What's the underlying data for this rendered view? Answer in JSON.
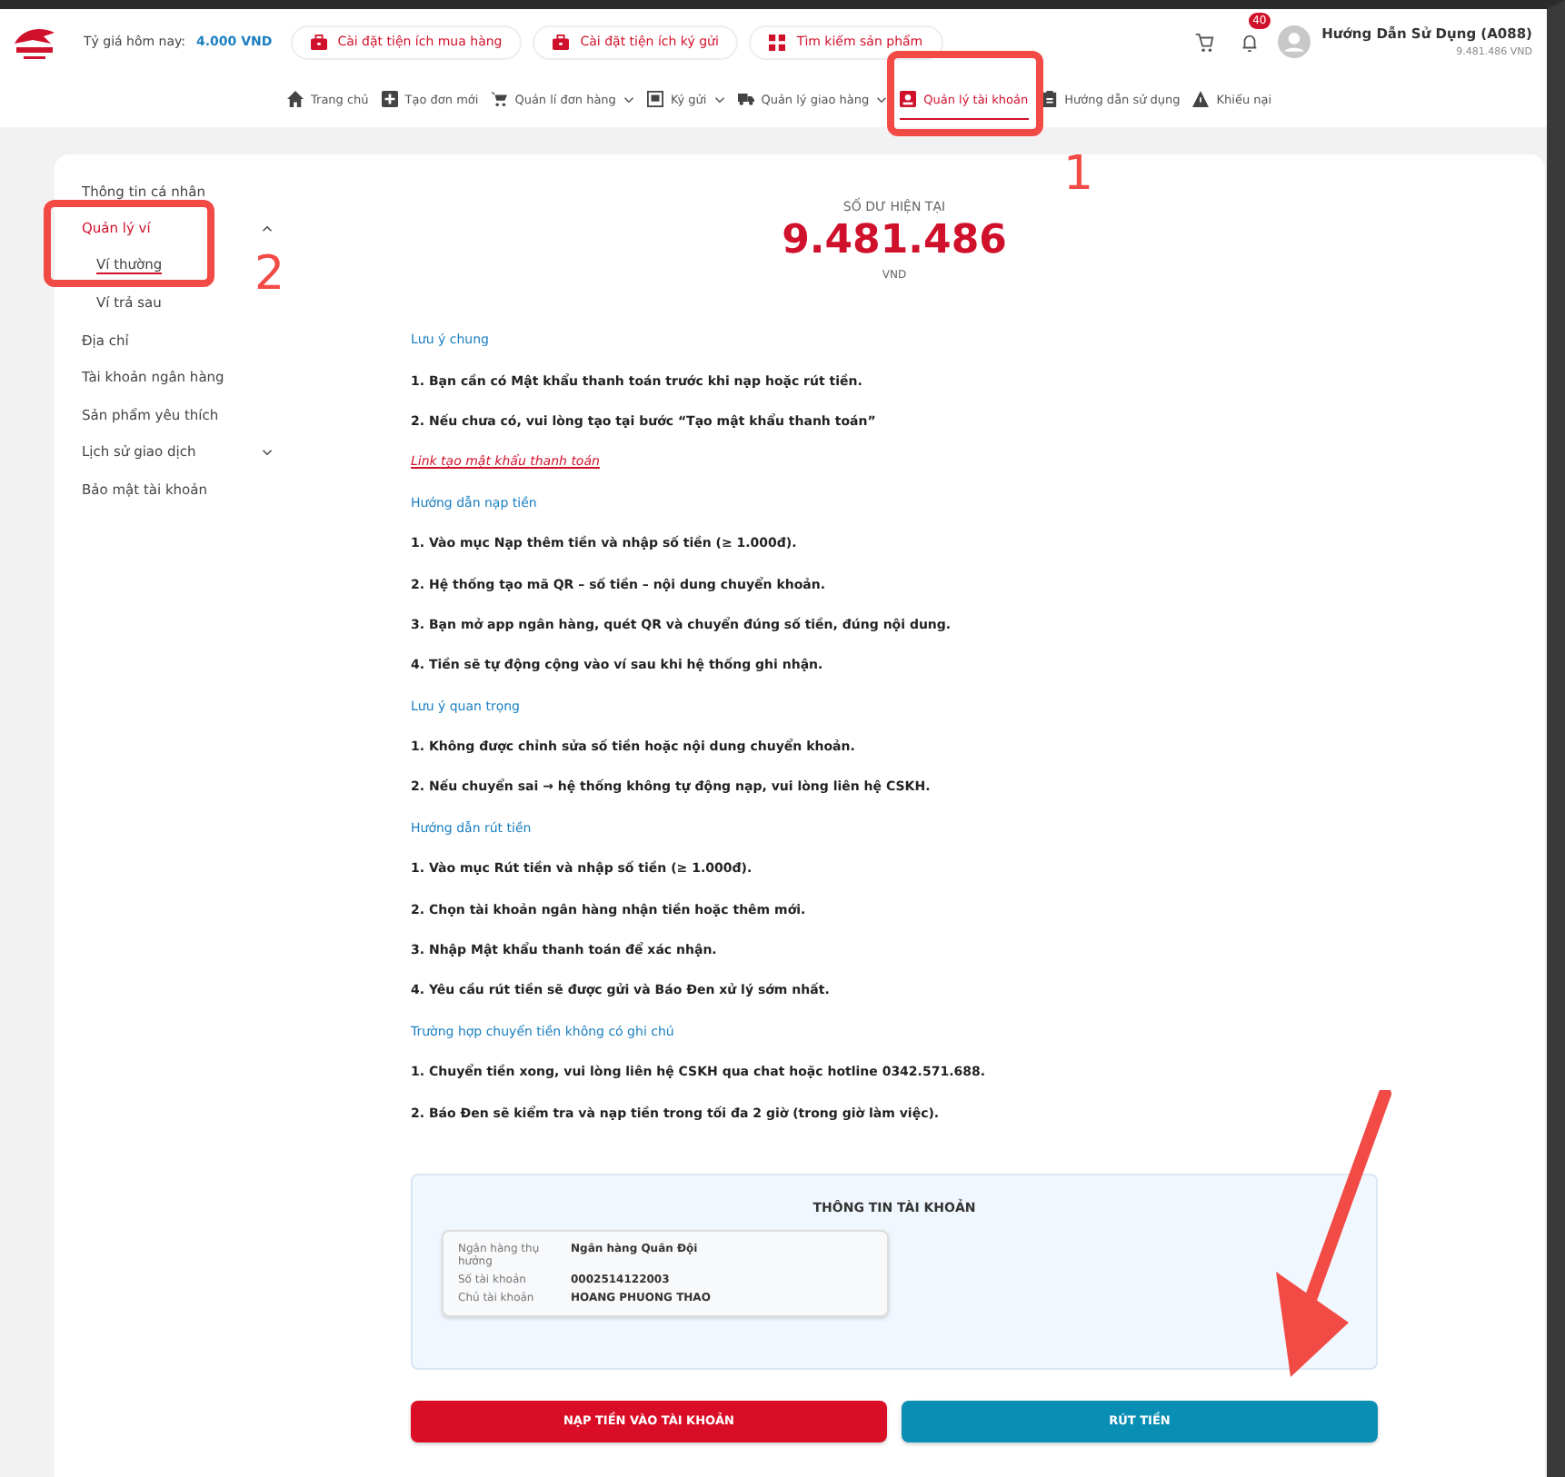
{
  "header": {
    "rate_label": "Tỷ giá hôm nay:",
    "rate_value": "4.000 VND",
    "quick_buttons": [
      {
        "label": "Cài đặt tiện ích mua hàng"
      },
      {
        "label": "Cài đặt tiện ích ký gửi"
      },
      {
        "label": "Tìm kiếm sản phẩm"
      }
    ],
    "notification_count": "40",
    "user": {
      "name": "Hướng Dẫn Sử Dụng (A088)",
      "balance": "9.481.486 VND"
    }
  },
  "nav": [
    {
      "label": "Trang chủ",
      "dropdown": false,
      "selected": false
    },
    {
      "label": "Tạo đơn mới",
      "dropdown": false,
      "selected": false
    },
    {
      "label": "Quản lí đơn hàng",
      "dropdown": true,
      "selected": false
    },
    {
      "label": "Ký gửi",
      "dropdown": true,
      "selected": false
    },
    {
      "label": "Quản lý giao hàng",
      "dropdown": true,
      "selected": false
    },
    {
      "label": "Quản lý tài khoản",
      "dropdown": false,
      "selected": true
    },
    {
      "label": "Hướng dẫn sử dụng",
      "dropdown": false,
      "selected": false
    },
    {
      "label": "Khiếu nại",
      "dropdown": false,
      "selected": false
    }
  ],
  "sidebar": [
    {
      "label": "Thông tin cá nhân",
      "selected": false
    },
    {
      "label": "Quản lý ví",
      "selected": true,
      "expanded": true,
      "children": [
        {
          "label": "Ví thường",
          "selected": true
        },
        {
          "label": "Ví trả sau",
          "selected": false
        }
      ]
    },
    {
      "label": "Địa chỉ",
      "selected": false
    },
    {
      "label": "Tài khoản ngân hàng",
      "selected": false
    },
    {
      "label": "Sản phẩm yêu thích",
      "selected": false
    },
    {
      "label": "Lịch sử giao dịch",
      "selected": false,
      "expanded": false
    },
    {
      "label": "Bảo mật tài khoản",
      "selected": false
    }
  ],
  "balance": {
    "label": "SỐ DƯ HIỆN TẠI",
    "amount": "9.481.486",
    "currency": "VND"
  },
  "guide": [
    {
      "kind": "heading",
      "text": "Lưu ý chung"
    },
    {
      "kind": "step",
      "text": "1. Bạn cần có Mật khẩu thanh toán trước khi nạp hoặc rút tiền."
    },
    {
      "kind": "step",
      "text": "2. Nếu chưa có, vui lòng tạo tại bước “Tạo mật khẩu thanh toán”"
    },
    {
      "kind": "link",
      "text": "Link tạo mật khẩu thanh toán"
    },
    {
      "kind": "heading",
      "text": "Hướng dẫn nạp tiền"
    },
    {
      "kind": "step",
      "text": "1. Vào mục Nạp thêm tiền và nhập số tiền (≥ 1.000đ)."
    },
    {
      "kind": "step",
      "text": "2. Hệ thống tạo mã QR – số tiền – nội dung chuyển khoản."
    },
    {
      "kind": "step",
      "text": "3. Bạn mở app ngân hàng, quét QR và chuyển đúng số tiền, đúng nội dung."
    },
    {
      "kind": "step",
      "text": "4. Tiền sẽ tự động cộng vào ví sau khi hệ thống ghi nhận."
    },
    {
      "kind": "heading",
      "text": "Lưu ý quan trọng"
    },
    {
      "kind": "step",
      "text": "1. Không được chỉnh sửa số tiền hoặc nội dung chuyển khoản."
    },
    {
      "kind": "step",
      "text": "2. Nếu chuyển sai → hệ thống không tự động nạp, vui lòng liên hệ CSKH."
    },
    {
      "kind": "heading",
      "text": "Hướng dẫn rút tiền"
    },
    {
      "kind": "step",
      "text": "1. Vào mục Rút tiền và nhập số tiền (≥ 1.000đ)."
    },
    {
      "kind": "step",
      "text": "2. Chọn tài khoản ngân hàng nhận tiền hoặc thêm mới."
    },
    {
      "kind": "step",
      "text": "3. Nhập Mật khẩu thanh toán để xác nhận."
    },
    {
      "kind": "step",
      "text": "4. Yêu cầu rút tiền sẽ được gửi và Báo Đen xử lý sớm nhất."
    },
    {
      "kind": "heading",
      "text": "Trường hợp chuyển tiền không có ghi chú"
    },
    {
      "kind": "step",
      "text": "1. Chuyển tiền xong, vui lòng liên hệ CSKH qua chat hoặc hotline 0342.571.688."
    },
    {
      "kind": "step",
      "text": "2. Báo Đen sẽ kiểm tra và nạp tiền trong tối đa 2 giờ (trong giờ làm việc)."
    }
  ],
  "account_info": {
    "title": "THÔNG TIN TÀI KHOẢN",
    "rows": [
      {
        "label": "Ngân hàng thụ hưởng",
        "value": "Ngân hàng Quân Đội"
      },
      {
        "label": "Số tài khoản",
        "value": "0002514122003"
      },
      {
        "label": "Chủ tài khoản",
        "value": "HOANG PHUONG THAO"
      }
    ]
  },
  "actions": [
    {
      "label": "NẠP TIỀN VÀO TÀI KHOẢN",
      "kind": "deposit"
    },
    {
      "label": "RÚT TIỀN",
      "kind": "withdraw"
    }
  ],
  "annotations": [
    {
      "label": "1"
    },
    {
      "label": "2"
    }
  ]
}
